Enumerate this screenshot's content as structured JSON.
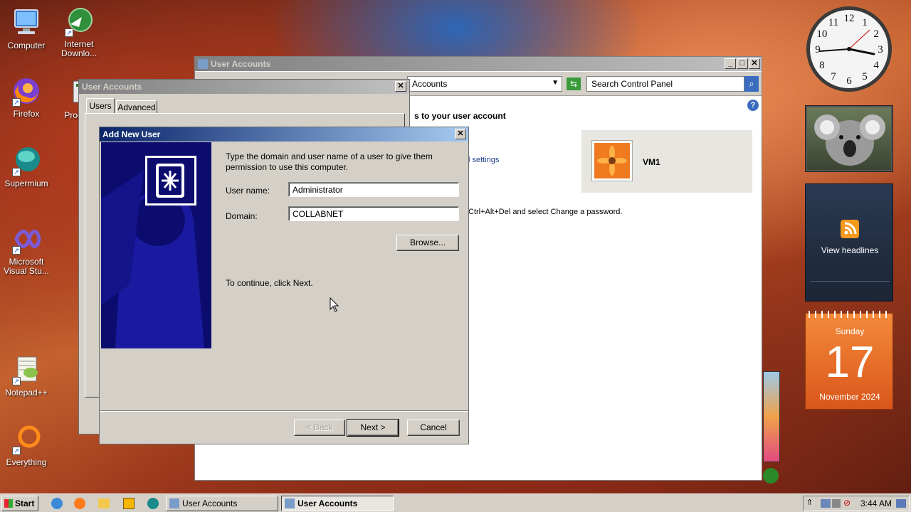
{
  "desktop": {
    "icons": [
      {
        "label": "Computer"
      },
      {
        "label": "Internet Downlo..."
      },
      {
        "label": "Firefox"
      },
      {
        "label": "Proc Hack"
      },
      {
        "label": "Supermium"
      },
      {
        "label": "Microsoft Visual Stu..."
      },
      {
        "label": "Notepad++"
      },
      {
        "label": "Everything"
      }
    ]
  },
  "control_panel": {
    "title": "User Accounts",
    "address": "Accounts",
    "search_placeholder": "Search Control Panel",
    "heading_fragment": "s to your user account",
    "settings_fragment": "l settings",
    "password_hint_fragment": "Ctrl+Alt+Del and select Change a password.",
    "account_name": "VM1"
  },
  "user_accounts_dialog": {
    "title": "User Accounts",
    "tabs": [
      "Users",
      "Advanced"
    ]
  },
  "add_user_dialog": {
    "title": "Add New User",
    "intro": "Type the domain and user name of a user to give them permission to use this computer.",
    "username_label": "User name:",
    "username_value": "Administrator",
    "domain_label": "Domain:",
    "domain_value": "COLLABNET",
    "browse_label": "Browse...",
    "continue_text": "To continue, click Next.",
    "back_label": "< Back",
    "next_label": "Next >",
    "cancel_label": "Cancel"
  },
  "gadgets": {
    "clock_numbers": [
      "12",
      "1",
      "2",
      "3",
      "4",
      "5",
      "6",
      "7",
      "8",
      "9",
      "10",
      "11"
    ],
    "feed_label": "View headlines",
    "calendar_day": "Sunday",
    "calendar_date": "17",
    "calendar_month": "November 2024"
  },
  "taskbar": {
    "start_label": "Start",
    "tasks": [
      "User Accounts",
      "User Accounts"
    ],
    "clock": "3:44 AM"
  },
  "colors": {
    "title_active": "#0a246a",
    "calendar_orange": "#e8671a",
    "dialog_banner": "#0c0c6e"
  }
}
